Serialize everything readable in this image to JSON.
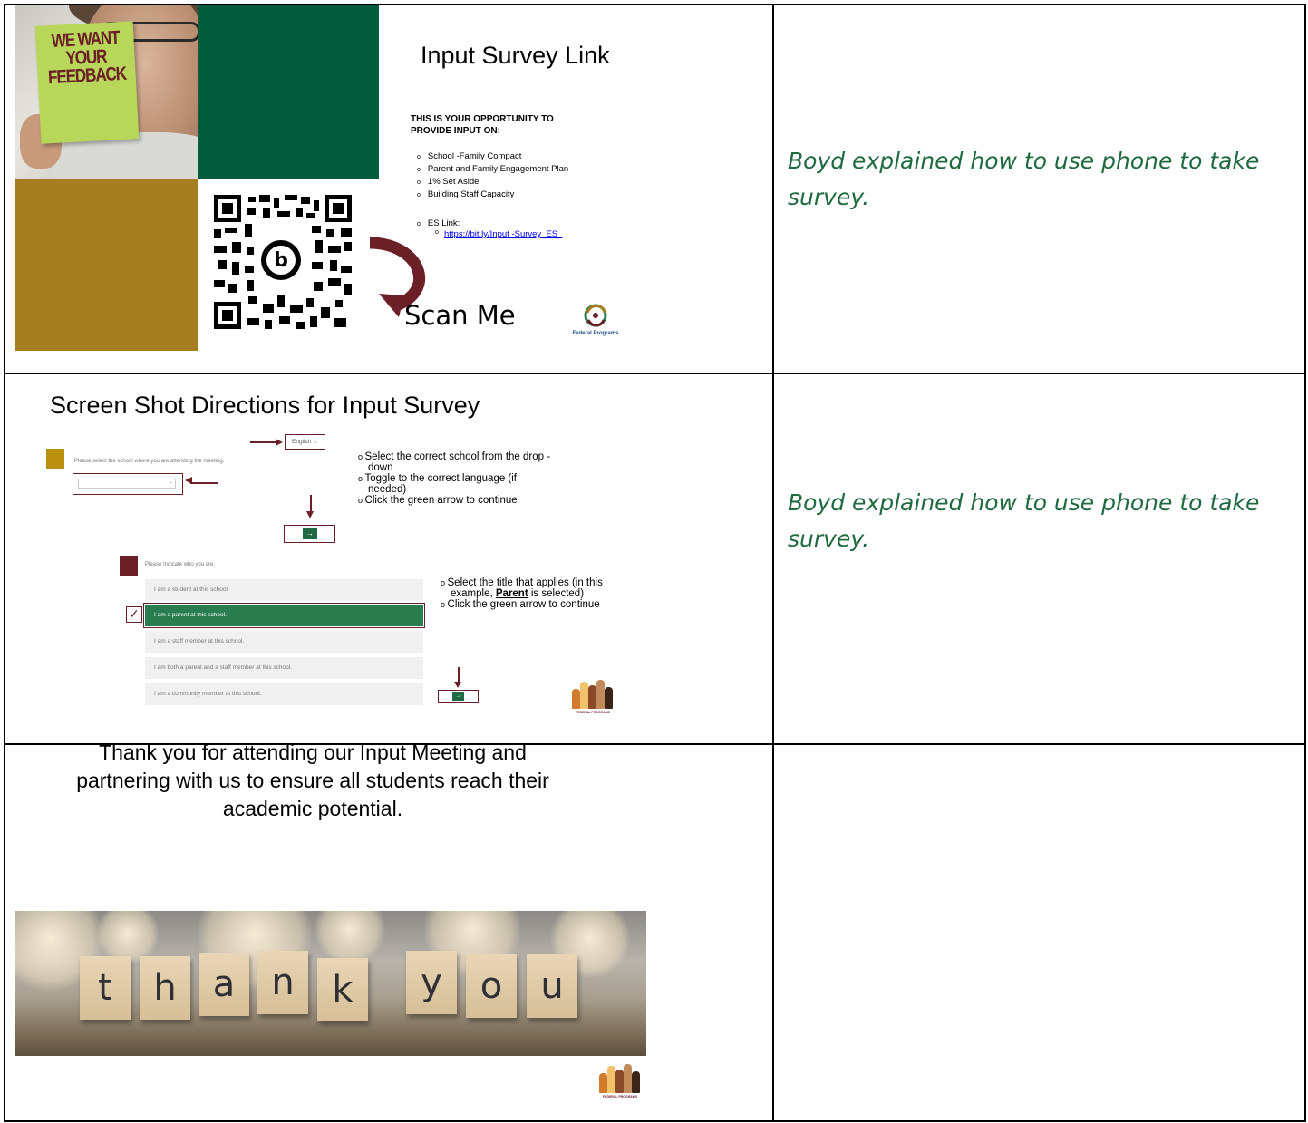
{
  "slide1": {
    "sticky_lines": [
      "WE WANT",
      "YOUR",
      "FEEDBACK"
    ],
    "title": "Input Survey Link",
    "heading": "THIS IS YOUR OPPORTUNITY TO PROVIDE INPUT ON:",
    "items": [
      "School -Family Compact",
      "Parent and Family Engagement Plan",
      "1% Set Aside",
      "Building Staff Capacity"
    ],
    "es_label": "ES Link:",
    "es_url": "https://bit.ly/Input    -Survey_ES_",
    "scan_label": "Scan Me",
    "logo_text": "Federal Programs",
    "colors": {
      "green": "#005c3c",
      "gold": "#a57e22",
      "maroon": "#6b1f26"
    }
  },
  "slide2": {
    "title": "Screen Shot Directions for Input Survey",
    "school_prompt": "Please select the school where you are attending the meeting.",
    "language_selected": "English",
    "instructions_top": [
      "Select the correct school from the drop -down",
      "Toggle to the correct language (if needed)",
      "Click the green arrow to continue"
    ],
    "who_prompt": "Please Indicate who you are.",
    "choices": [
      "I am a student at this school.",
      "I am a parent at this school.",
      "I am a staff member at this school.",
      "I am both a parent and a staff member at this school.",
      "I am a community member at this school."
    ],
    "selected_index": 1,
    "instr_bottom_1a": "Select the title that applies (in this example,",
    "instr_bottom_1b": "Parent",
    "instr_bottom_1c": "is selected)",
    "instr_bottom_2": "Click the green arrow to continue",
    "arrow_glyph": "→",
    "logo_text": "FEDERAL PROGRAMS"
  },
  "slide3": {
    "message": "Thank you for attending our Input Meeting and partnering with us to ensure all students reach their academic potential.",
    "tiles": [
      "t",
      "h",
      "a",
      "n",
      "k",
      "y",
      "o",
      "u"
    ],
    "logo_text": "FEDERAL PROGRAMS"
  },
  "notes": [
    "Boyd explained how to use phone to take survey.",
    "Boyd explained how to use phone to take survey.",
    ""
  ]
}
